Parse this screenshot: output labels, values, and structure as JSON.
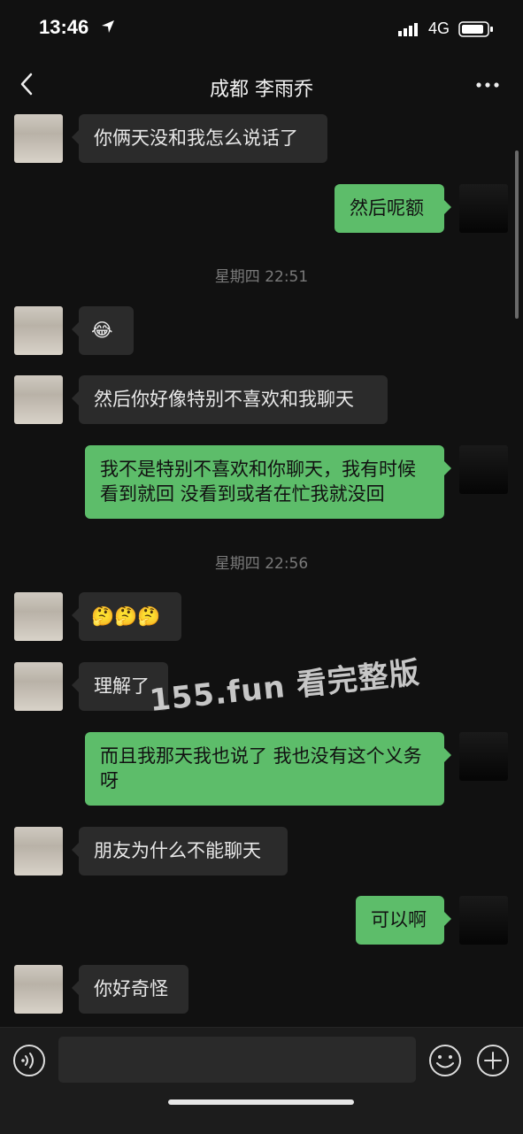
{
  "status_bar": {
    "time": "13:46",
    "network": "4G"
  },
  "nav": {
    "title": "成都 李雨乔"
  },
  "messages": [
    {
      "text": "你俩天没和我怎么说话了"
    },
    {
      "text": "然后呢额"
    },
    {
      "text": "星期四 22:51"
    },
    {
      "text": "😂"
    },
    {
      "text": "然后你好像特别不喜欢和我聊天"
    },
    {
      "text": "我不是特别不喜欢和你聊天，我有时候看到就回  没看到或者在忙我就没回"
    },
    {
      "text": "星期四 22:56"
    },
    {
      "text": "🤔🤔🤔"
    },
    {
      "text": "理解了"
    },
    {
      "text": "而且我那天我也说了  我也没有这个义务呀"
    },
    {
      "text": "朋友为什么不能聊天"
    },
    {
      "text": "可以啊"
    },
    {
      "text": "你好奇怪"
    }
  ],
  "watermark": "155.fun 看完整版",
  "input": {
    "value": ""
  },
  "colors": {
    "background": "#111111",
    "bubble_me": "#5dbd6a",
    "bubble_them": "#2b2b2b"
  }
}
